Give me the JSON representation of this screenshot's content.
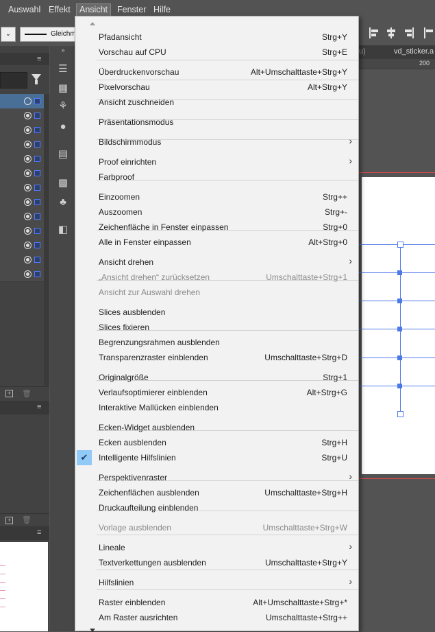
{
  "menubar": {
    "items": [
      {
        "label": "Auswahl",
        "active": false
      },
      {
        "label": "Effekt",
        "active": false
      },
      {
        "label": "Ansicht",
        "active": true
      },
      {
        "label": "Fenster",
        "active": false
      },
      {
        "label": "Hilfe",
        "active": false
      }
    ]
  },
  "control_bar": {
    "stroke_label": "Gleichm"
  },
  "document_tabs": {
    "partial_tab": "u)",
    "tab_name": "vd_sticker.a"
  },
  "ruler": {
    "tick_label": "200"
  },
  "menu": {
    "items": [
      {
        "label": "Pfadansicht",
        "shortcut": "Strg+Y"
      },
      {
        "label": "Vorschau auf CPU",
        "shortcut": "Strg+E"
      },
      {
        "label": "Überdruckenvorschau",
        "shortcut": "Alt+Umschalttaste+Strg+Y"
      },
      {
        "label": "Pixelvorschau",
        "shortcut": "Alt+Strg+Y"
      },
      {
        "label": "Ansicht zuschneiden",
        "shortcut": ""
      },
      {
        "label": "Präsentationsmodus",
        "shortcut": ""
      },
      {
        "label": "Bildschirmmodus",
        "shortcut": "",
        "submenu": true
      },
      {
        "label": "Proof einrichten",
        "shortcut": "",
        "submenu": true
      },
      {
        "label": "Farbproof",
        "shortcut": ""
      },
      {
        "label": "Einzoomen",
        "shortcut": "Strg++"
      },
      {
        "label": "Auszoomen",
        "shortcut": "Strg+-"
      },
      {
        "label": "Zeichenfläche in Fenster einpassen",
        "shortcut": "Strg+0"
      },
      {
        "label": "Alle in Fenster einpassen",
        "shortcut": "Alt+Strg+0"
      },
      {
        "label": "Ansicht drehen",
        "shortcut": "",
        "submenu": true
      },
      {
        "label": "„Ansicht drehen“ zurücksetzen",
        "shortcut": "Umschalttaste+Strg+1",
        "disabled": true
      },
      {
        "label": "Ansicht zur Auswahl drehen",
        "shortcut": "",
        "disabled": true
      },
      {
        "label": "Slices ausblenden",
        "shortcut": ""
      },
      {
        "label": "Slices fixieren",
        "shortcut": ""
      },
      {
        "label": "Begrenzungsrahmen ausblenden",
        "shortcut": ""
      },
      {
        "label": "Transparenzraster einblenden",
        "shortcut": "Umschalttaste+Strg+D"
      },
      {
        "label": "Originalgröße",
        "shortcut": "Strg+1"
      },
      {
        "label": "Verlaufsoptimierer einblenden",
        "shortcut": "Alt+Strg+G"
      },
      {
        "label": "Interaktive Mallücken einblenden",
        "shortcut": ""
      },
      {
        "label": "Ecken-Widget ausblenden",
        "shortcut": ""
      },
      {
        "label": "Ecken ausblenden",
        "shortcut": "Strg+H"
      },
      {
        "label": "Intelligente Hilfslinien",
        "shortcut": "Strg+U",
        "checked": true
      },
      {
        "label": "Perspektivenraster",
        "shortcut": "",
        "submenu": true
      },
      {
        "label": "Zeichenflächen ausblenden",
        "shortcut": "Umschalttaste+Strg+H"
      },
      {
        "label": "Druckaufteilung einblenden",
        "shortcut": ""
      },
      {
        "label": "Vorlage ausblenden",
        "shortcut": "Umschalttaste+Strg+W",
        "disabled": true
      },
      {
        "label": "Lineale",
        "shortcut": "",
        "submenu": true
      },
      {
        "label": "Textverkettungen ausblenden",
        "shortcut": "Umschalttaste+Strg+Y"
      },
      {
        "label": "Hilfslinien",
        "shortcut": "",
        "submenu": true
      },
      {
        "label": "Raster einblenden",
        "shortcut": "Alt+Umschalttaste+Strg+*"
      },
      {
        "label": "Am Raster ausrichten",
        "shortcut": "Umschalttaste+Strg++"
      }
    ]
  },
  "icons": {
    "submenu": "chevron-right-icon",
    "check": "checkmark-icon"
  },
  "colors": {
    "menu_bg": "#f2f2f2",
    "highlight": "#91c9f7",
    "selection_blue": "#4c78e8",
    "layer_selected": "#4a6f97"
  }
}
